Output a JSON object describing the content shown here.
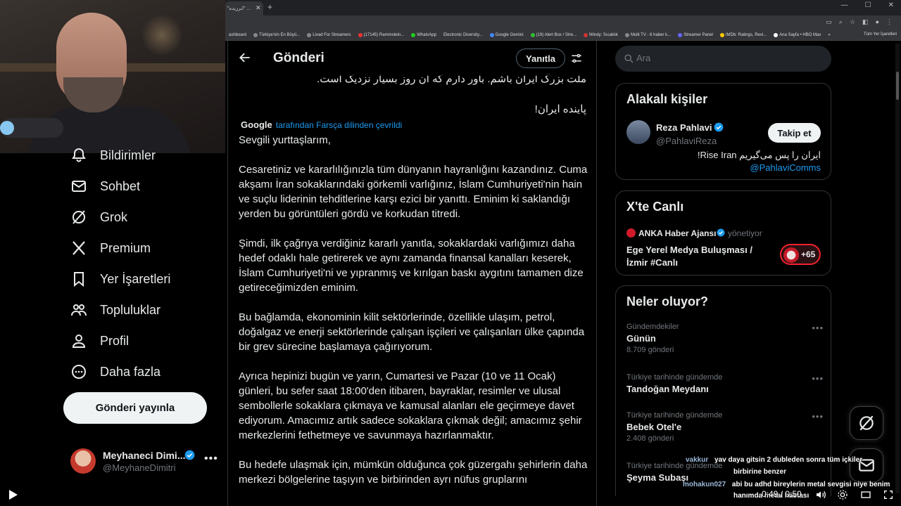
{
  "browser": {
    "tab_title": "\"ابرزیده\" ...",
    "bookmarks": [
      "ashboard",
      "Türkiye'nin En Büyü...",
      "Livad For Streamers",
      "(17145) Rammstein...",
      "WhatsApp",
      "Electronic Diversity...",
      "Google Gemini",
      "(19) Alert Box / Stre...",
      "Windy: Sıcaklık",
      "Multi TV - 6 haber k...",
      "Streamer Panel",
      "IMDb: Ratings, Revi...",
      "Ana Sayfa • HBO Max"
    ],
    "bookmarks_more": "»",
    "bookmarks_all": "Tüm Yer İşaretleri"
  },
  "nav": {
    "items": [
      {
        "label": "Bildirimler",
        "icon": "bell-icon"
      },
      {
        "label": "Sohbet",
        "icon": "mail-icon"
      },
      {
        "label": "Grok",
        "icon": "grok-icon"
      },
      {
        "label": "Premium",
        "icon": "x-logo-icon"
      },
      {
        "label": "Yer İşaretleri",
        "icon": "bookmark-icon"
      },
      {
        "label": "Topluluklar",
        "icon": "people-icon"
      },
      {
        "label": "Profil",
        "icon": "person-icon"
      },
      {
        "label": "Daha fazla",
        "icon": "more-circle-icon"
      }
    ],
    "post_button": "Gönderi yayınla"
  },
  "account": {
    "name": "Meyhaneci Dimi...",
    "handle": "@MeyhaneDimitri",
    "more": "•••"
  },
  "main": {
    "title": "Gönderi",
    "reply_label": "Yanıtla",
    "rtl_line_1": "ملت بزرگ ایران باشم. باور دارم که ان روز بسیار نزدیک است.",
    "rtl_line_2": "پاینده ایران!",
    "google_label": "Google",
    "translated_label": "tarafından Farsça dilinden çevrildi",
    "paragraphs": [
      "Sevgili yurttaşlarım,",
      "Cesaretiniz ve kararlılığınızla tüm dünyanın hayranlığını kazandınız. Cuma akşamı İran sokaklarındaki görkemli varlığınız, İslam Cumhuriyeti'nin hain ve suçlu liderinin tehditlerine karşı ezici bir yanıttı. Eminim ki saklandığı yerden bu görüntüleri gördü ve korkudan titredi.",
      "Şimdi, ilk çağrıya verdiğiniz kararlı yanıtla, sokaklardaki varlığımızı daha hedef odaklı hale getirerek ve aynı zamanda finansal kanalları keserek, İslam Cumhuriyeti'ni ve yıpranmış ve kırılgan baskı aygıtını tamamen dize getireceğimizden eminim.",
      "Bu bağlamda, ekonominin kilit sektörlerinde, özellikle ulaşım, petrol, doğalgaz ve enerji sektörlerinde çalışan işçileri ve çalışanları ülke çapında bir grev sürecine başlamaya çağırıyorum.",
      "Ayrıca hepinizi bugün ve yarın, Cumartesi ve Pazar (10 ve 11 Ocak) günleri, bu sefer saat 18:00'den itibaren, bayraklar, resimler ve ulusal sembollerle sokaklara çıkmaya ve kamusal alanları ele geçirmeye davet ediyorum. Amacımız artık sadece sokaklara çıkmak değil; amacımız şehir merkezlerini fethetmeye ve savunmaya hazırlanmaktır.",
      "Bu hedefe ulaşmak için, mümkün olduğunca çok güzergahı şehirlerin daha merkezi bölgelerine taşıyın ve birbirinden ayrı nüfus gruplarını"
    ]
  },
  "sidebar": {
    "search_placeholder": "Ara",
    "related": {
      "title": "Alakalı kişiler",
      "name": "Reza Pahlavi",
      "handle": "@PahlaviReza",
      "follow_label": "Takip et",
      "bio": "ایران را پس می‌گیریم Rise Iran!",
      "link": "@PahlaviComms"
    },
    "live": {
      "title": "X'te Canlı",
      "host": "ANKA Haber Ajansı",
      "role": "yönetiyor",
      "space_title": "Ege Yerel Medya Buluşması / İzmir #Canlı",
      "listeners": "+65"
    },
    "trends": {
      "title": "Neler oluyor?",
      "items": [
        {
          "category": "Gündemdekiler",
          "name": "Günün",
          "count": "8.709 gönderi"
        },
        {
          "category": "Türkiye tarihinde gündemde",
          "name": "Tandoğan Meydanı",
          "count": ""
        },
        {
          "category": "Türkiye tarihinde gündemde",
          "name": "Bebek Otel'e",
          "count": "2.408 gönderi"
        },
        {
          "category": "Türkiye tarihinde gündemde",
          "name": "Şeyma Subaşı",
          "count": ""
        }
      ],
      "more": "•••"
    }
  },
  "chat": [
    {
      "user": "vakkur",
      "text": "yav daya gitsin 2 dubleden sonra tüm içkiler"
    },
    {
      "user": "",
      "text": "birbirine benzer"
    },
    {
      "user": "mohakun027",
      "text": "abi bu adhd bireylerin metal sevgisi niye benim"
    },
    {
      "user": "",
      "text": "hanımda metal hastası"
    }
  ],
  "player": {
    "time": "0:49 / 0:50"
  },
  "colors": {
    "accent": "#1d9bf0",
    "background": "#000000",
    "text": "#e7e9ea",
    "muted": "#71767b",
    "live_red": "#f4212e"
  }
}
